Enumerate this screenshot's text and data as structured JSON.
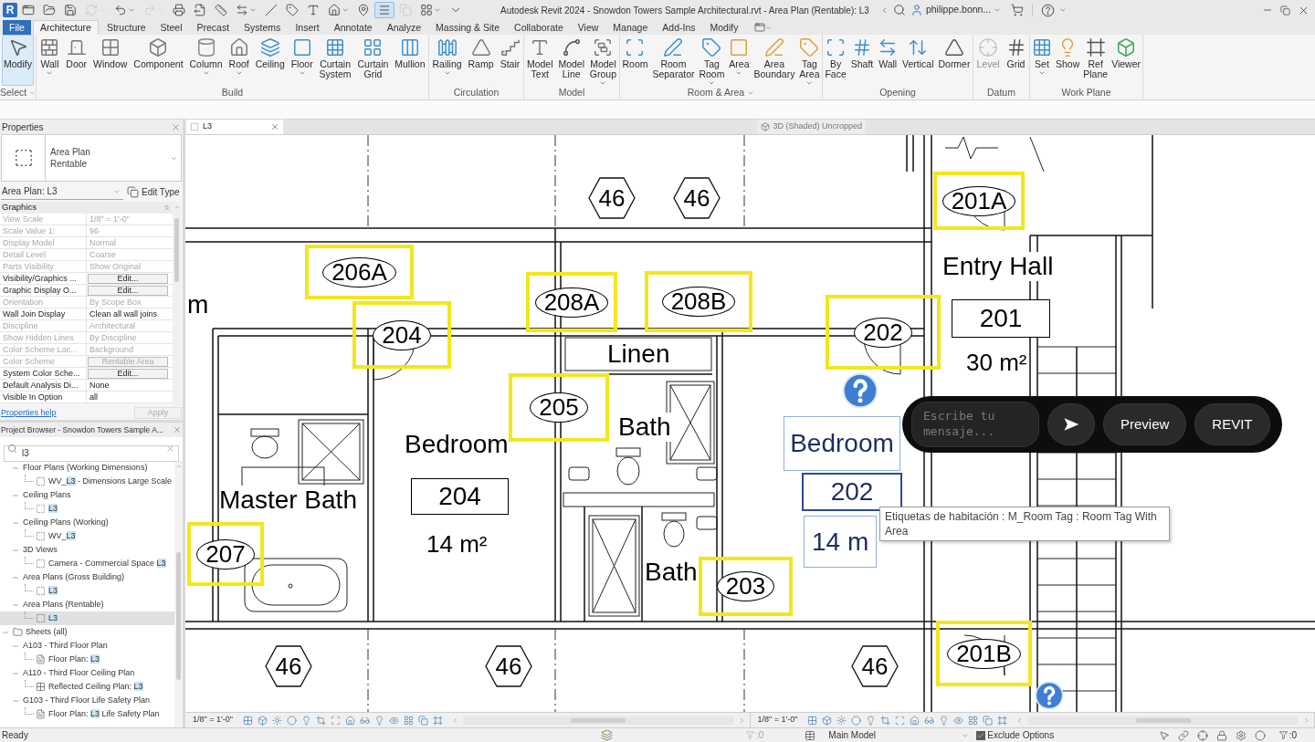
{
  "window": {
    "app_logo": "R",
    "title": "Autodesk Revit 2024 - Snowdon Towers Sample Architectural.rvt - Area Plan (Rentable): L3",
    "user": "philippe.bonn..."
  },
  "quick_access": [
    {
      "on": false,
      "menu": false,
      "disabled": false
    },
    {
      "on": false,
      "menu": false,
      "disabled": false
    },
    {
      "on": false,
      "menu": false,
      "disabled": false
    },
    {
      "on": false,
      "menu": true,
      "disabled": true
    },
    {
      "on": false,
      "menu": true,
      "disabled": false
    },
    {
      "on": false,
      "menu": true,
      "disabled": true
    },
    {
      "on": false,
      "menu": false,
      "disabled": false
    },
    {
      "on": false,
      "menu": false,
      "disabled": false
    },
    {
      "on": false,
      "menu": false,
      "disabled": false
    },
    {
      "on": false,
      "menu": true,
      "disabled": false
    },
    {
      "on": false,
      "menu": false,
      "disabled": false
    },
    {
      "on": false,
      "menu": false,
      "disabled": false
    },
    {
      "on": false,
      "menu": false,
      "disabled": false
    },
    {
      "on": false,
      "menu": true,
      "disabled": false
    },
    {
      "on": false,
      "menu": false,
      "disabled": false
    },
    {
      "on": true,
      "menu": false,
      "disabled": false
    },
    {
      "on": false,
      "menu": false,
      "disabled": true
    },
    {
      "on": false,
      "menu": true,
      "disabled": false
    },
    {
      "on": false,
      "menu": false,
      "disabled": false
    }
  ],
  "ribbon_tabs": [
    {
      "label": "File",
      "kind": "app",
      "selected": false
    },
    {
      "label": "Architecture",
      "kind": "tab",
      "selected": true
    },
    {
      "label": "Structure",
      "kind": "tab",
      "selected": false
    },
    {
      "label": "Steel",
      "kind": "tab",
      "selected": false
    },
    {
      "label": "Precast",
      "kind": "tab",
      "selected": false
    },
    {
      "label": "Systems",
      "kind": "tab",
      "selected": false
    },
    {
      "label": "Insert",
      "kind": "tab",
      "selected": false
    },
    {
      "label": "Annotate",
      "kind": "tab",
      "selected": false
    },
    {
      "label": "Analyze",
      "kind": "tab",
      "selected": false
    },
    {
      "label": "Massing & Site",
      "kind": "tab",
      "selected": false
    },
    {
      "label": "Collaborate",
      "kind": "tab",
      "selected": false
    },
    {
      "label": "View",
      "kind": "tab",
      "selected": false
    },
    {
      "label": "Manage",
      "kind": "tab",
      "selected": false
    },
    {
      "label": "Add-Ins",
      "kind": "tab",
      "selected": false
    },
    {
      "label": "Modify",
      "kind": "tab",
      "selected": false
    }
  ],
  "ribbon_panels": [
    {
      "title": "Select",
      "menu": true,
      "tools": [
        {
          "label": "Modify",
          "menu": false,
          "active": true,
          "disabled": false
        }
      ]
    },
    {
      "title": "Build",
      "menu": false,
      "tools": [
        {
          "label": "Wall",
          "menu": true,
          "active": false,
          "disabled": false
        },
        {
          "label": "Door",
          "menu": false,
          "active": false,
          "disabled": false
        },
        {
          "label": "Window",
          "menu": false,
          "active": false,
          "disabled": false
        },
        {
          "label": "Component",
          "menu": false,
          "active": false,
          "disabled": false
        },
        {
          "label": "Column",
          "menu": true,
          "active": false,
          "disabled": false
        },
        {
          "label": "Roof",
          "menu": true,
          "active": false,
          "disabled": false
        },
        {
          "label": "Ceiling",
          "menu": false,
          "active": false,
          "disabled": false
        },
        {
          "label": "Floor",
          "menu": true,
          "active": false,
          "disabled": false
        },
        {
          "label": "Curtain System",
          "menu": false,
          "active": false,
          "disabled": false
        },
        {
          "label": "Curtain Grid",
          "menu": false,
          "active": false,
          "disabled": false
        },
        {
          "label": "Mullion",
          "menu": false,
          "active": false,
          "disabled": false
        }
      ]
    },
    {
      "title": "Circulation",
      "menu": false,
      "tools": [
        {
          "label": "Railing",
          "menu": true,
          "active": false,
          "disabled": false
        },
        {
          "label": "Ramp",
          "menu": false,
          "active": false,
          "disabled": false
        },
        {
          "label": "Stair",
          "menu": false,
          "active": false,
          "disabled": false
        }
      ]
    },
    {
      "title": "Model",
      "menu": false,
      "tools": [
        {
          "label": "Model Text",
          "menu": false,
          "active": false,
          "disabled": false
        },
        {
          "label": "Model Line",
          "menu": false,
          "active": false,
          "disabled": false
        },
        {
          "label": "Model Group",
          "menu": true,
          "active": false,
          "disabled": false
        }
      ]
    },
    {
      "title": "Room & Area",
      "menu": true,
      "tools": [
        {
          "label": "Room",
          "menu": false,
          "active": false,
          "disabled": false
        },
        {
          "label": "Room Separator",
          "menu": false,
          "active": false,
          "disabled": false
        },
        {
          "label": "Tag Room",
          "menu": true,
          "active": false,
          "disabled": false
        },
        {
          "label": "Area",
          "menu": true,
          "active": false,
          "disabled": false
        },
        {
          "label": "Area Boundary",
          "menu": false,
          "active": false,
          "disabled": false
        },
        {
          "label": "Tag Area",
          "menu": true,
          "active": false,
          "disabled": false
        }
      ]
    },
    {
      "title": "Opening",
      "menu": false,
      "tools": [
        {
          "label": "By Face",
          "menu": false,
          "active": false,
          "disabled": false
        },
        {
          "label": "Shaft",
          "menu": false,
          "active": false,
          "disabled": false
        },
        {
          "label": "Wall",
          "menu": false,
          "active": false,
          "disabled": false
        },
        {
          "label": "Vertical",
          "menu": false,
          "active": false,
          "disabled": false
        },
        {
          "label": "Dormer",
          "menu": false,
          "active": false,
          "disabled": false
        }
      ]
    },
    {
      "title": "Datum",
      "menu": false,
      "tools": [
        {
          "label": "Level",
          "menu": false,
          "active": false,
          "disabled": true
        },
        {
          "label": "Grid",
          "menu": false,
          "active": false,
          "disabled": false
        }
      ]
    },
    {
      "title": "Work Plane",
      "menu": false,
      "tools": [
        {
          "label": "Set",
          "menu": true,
          "active": false,
          "disabled": false
        },
        {
          "label": "Show",
          "menu": false,
          "active": false,
          "disabled": false
        },
        {
          "label": "Ref Plane",
          "menu": false,
          "active": false,
          "disabled": false
        },
        {
          "label": "Viewer",
          "menu": false,
          "active": false,
          "disabled": false
        }
      ]
    }
  ],
  "properties": {
    "title": "Properties",
    "type_family": "Area Plan",
    "type_name": "Rentable",
    "instance": "Area Plan: L3",
    "edit_type": "Edit Type",
    "group": "Graphics",
    "rows": [
      {
        "name": "View Scale",
        "value": "1/8\" = 1'-0\"",
        "kind": "text",
        "disabled": true
      },
      {
        "name": "Scale Value 1:",
        "value": "96",
        "kind": "text",
        "disabled": true
      },
      {
        "name": "Display Model",
        "value": "Normal",
        "kind": "text",
        "disabled": true
      },
      {
        "name": "Detail Level",
        "value": "Coarse",
        "kind": "text",
        "disabled": true
      },
      {
        "name": "Parts Visibility",
        "value": "Show Original",
        "kind": "text",
        "disabled": true
      },
      {
        "name": "Visibility/Graphics ...",
        "value": "Edit...",
        "kind": "button",
        "disabled": false
      },
      {
        "name": "Graphic Display O...",
        "value": "Edit...",
        "kind": "button",
        "disabled": false
      },
      {
        "name": "Orientation",
        "value": "By Scope Box",
        "kind": "text",
        "disabled": true
      },
      {
        "name": "Wall Join Display",
        "value": "Clean all wall joins",
        "kind": "text",
        "disabled": false
      },
      {
        "name": "Discipline",
        "value": "Architectural",
        "kind": "text",
        "disabled": true
      },
      {
        "name": "Show Hidden Lines",
        "value": "By Discipline",
        "kind": "text",
        "disabled": true
      },
      {
        "name": "Color Scheme Loc...",
        "value": "Background",
        "kind": "text",
        "disabled": true
      },
      {
        "name": "Color Scheme",
        "value": "Rentable Area",
        "kind": "button",
        "disabled": true
      },
      {
        "name": "System Color Sche...",
        "value": "Edit...",
        "kind": "button",
        "disabled": false
      },
      {
        "name": "Default Analysis Di...",
        "value": "None",
        "kind": "text",
        "disabled": false
      },
      {
        "name": "Visible In Option",
        "value": "all",
        "kind": "text",
        "disabled": false
      }
    ],
    "help_link": "Properties help",
    "apply": {
      "label": "Apply",
      "disabled": true
    }
  },
  "project_browser": {
    "title": "Project Browser - Snowdon Towers Sample A...",
    "search": "l3",
    "tree": [
      {
        "children": [
          {
            "kind": "group",
            "label": [
              {
                "text": "Floor Plans (Working Dimensions)",
                "match": false
              }
            ],
            "expanded": true,
            "selected": false,
            "children": [
              {
                "kind": "plan",
                "label": [
                  {
                    "text": "WV_",
                    "match": false
                  },
                  {
                    "text": "L3",
                    "match": true
                  },
                  {
                    "text": " - Dimensions Large Scale",
                    "match": false
                  }
                ],
                "selected": false
              }
            ]
          },
          {
            "kind": "group",
            "label": [
              {
                "text": "Ceiling Plans",
                "match": false
              }
            ],
            "expanded": true,
            "selected": false,
            "children": [
              {
                "kind": "ceiling",
                "label": [
                  {
                    "text": "L3",
                    "match": true
                  }
                ],
                "selected": false
              }
            ]
          },
          {
            "kind": "group",
            "label": [
              {
                "text": "Ceiling Plans (Working)",
                "match": false
              }
            ],
            "expanded": true,
            "selected": false,
            "children": [
              {
                "kind": "plan",
                "label": [
                  {
                    "text": "WV_",
                    "match": false
                  },
                  {
                    "text": "L3",
                    "match": true
                  }
                ],
                "selected": false
              }
            ]
          },
          {
            "kind": "group",
            "label": [
              {
                "text": "3D Views",
                "match": false
              }
            ],
            "expanded": true,
            "selected": false,
            "children": [
              {
                "kind": "plan",
                "label": [
                  {
                    "text": "Camera - Commercial Space ",
                    "match": false
                  },
                  {
                    "text": "L3",
                    "match": true
                  }
                ],
                "selected": false
              }
            ]
          },
          {
            "kind": "group",
            "label": [
              {
                "text": "Area Plans (Gross Building)",
                "match": false
              }
            ],
            "expanded": true,
            "selected": false,
            "children": [
              {
                "kind": "plan",
                "label": [
                  {
                    "text": "L3",
                    "match": true
                  }
                ],
                "selected": false
              }
            ]
          },
          {
            "kind": "group",
            "label": [
              {
                "text": "Area Plans (Rentable)",
                "match": false
              }
            ],
            "expanded": true,
            "selected": false,
            "children": [
              {
                "kind": "plan",
                "label": [
                  {
                    "text": "L3",
                    "match": true
                  }
                ],
                "selected": true
              }
            ]
          }
        ]
      },
      {
        "kind": "folder",
        "label": [
          {
            "text": "Sheets (all)",
            "match": false
          }
        ],
        "expanded": true,
        "selected": false,
        "children": [
          {
            "kind": "group",
            "label": [
              {
                "text": "A103 - Third Floor Plan",
                "match": false
              }
            ],
            "expanded": true,
            "selected": false,
            "children": [
              {
                "kind": "sheetplan",
                "label": [
                  {
                    "text": "Floor Plan: ",
                    "match": false
                  },
                  {
                    "text": "L3",
                    "match": true
                  }
                ],
                "selected": false
              }
            ]
          },
          {
            "kind": "group",
            "label": [
              {
                "text": "A110 - Third Floor Ceiling Plan",
                "match": false
              }
            ],
            "expanded": true,
            "selected": false,
            "children": [
              {
                "kind": "sheetceiling",
                "label": [
                  {
                    "text": "Reflected Ceiling Plan: ",
                    "match": false
                  },
                  {
                    "text": "L3",
                    "match": true
                  }
                ],
                "selected": false
              }
            ]
          },
          {
            "kind": "group",
            "label": [
              {
                "text": "G103 - Third Floor Life Safety Plan",
                "match": false
              }
            ],
            "expanded": true,
            "selected": false,
            "children": [
              {
                "kind": "sheetplan",
                "label": [
                  {
                    "text": "Floor Plan: ",
                    "match": false
                  },
                  {
                    "text": "L3",
                    "match": true
                  },
                  {
                    "text": " Life Safety Plan",
                    "match": false
                  }
                ],
                "selected": false
              }
            ]
          }
        ]
      }
    ]
  },
  "view_tabs": [
    {
      "label": "L3",
      "selected": true,
      "closable": true
    },
    {
      "label": "3D (Shaded) Uncropped",
      "selected": false,
      "closable": false
    }
  ],
  "plan": {
    "rooms": [
      {
        "name": "m"
      },
      {
        "name": "Master Bath"
      },
      {
        "name": "Bedroom",
        "number": "204",
        "area": "14 m²"
      },
      {
        "name": "Linen"
      },
      {
        "name": "Bath"
      },
      {
        "name": "Bath"
      },
      {
        "name": "Entry Hall",
        "number": "201",
        "area": "30 m²"
      }
    ],
    "tags": [
      {
        "number": "206A",
        "highlighted": true
      },
      {
        "number": "204",
        "highlighted": true
      },
      {
        "number": "208A",
        "highlighted": true
      },
      {
        "number": "208B",
        "highlighted": true
      },
      {
        "number": "202",
        "highlighted": true
      },
      {
        "number": "201A",
        "highlighted": true
      },
      {
        "number": "205",
        "highlighted": true
      },
      {
        "number": "207",
        "highlighted": true
      },
      {
        "number": "203",
        "highlighted": true
      },
      {
        "number": "201B",
        "highlighted": true
      }
    ],
    "grid_heads": [
      "46",
      "46",
      "46",
      "46",
      "46"
    ],
    "selected_tag": {
      "name": "Bedroom",
      "number": "202",
      "area": "14 m"
    }
  },
  "chat": {
    "placeholder": "Escribe tu mensaje...",
    "buttons": [
      "Preview",
      "REVIT"
    ]
  },
  "tooltip": "Etiquetas de habitación : M_Room Tag : Room Tag With Area",
  "view_control_bars": [
    {
      "scale": "1/8\" = 1'-0\""
    },
    {
      "scale": "1/8\" = 1'-0\""
    }
  ],
  "status_bar": {
    "message": "Ready",
    "editable_only_count": ":0",
    "design_option": "Main Model",
    "exclude_options": {
      "label": "Exclude Options",
      "checked": true
    },
    "filter_count": ":0"
  }
}
